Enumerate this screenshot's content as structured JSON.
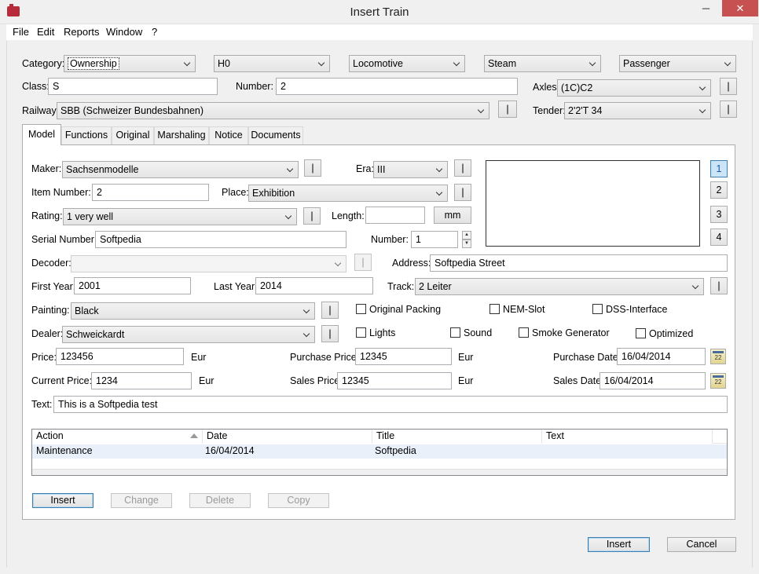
{
  "window": {
    "title": "Insert Train",
    "minimize": "─",
    "maximize": "□",
    "close": "✕"
  },
  "menu": [
    "File",
    "Edit",
    "Reports",
    "Window",
    "?"
  ],
  "header": {
    "category_label": "Category:",
    "category": "Ownership",
    "gauge": "H0",
    "type": "Locomotive",
    "traction": "Steam",
    "service": "Passenger",
    "class_label": "Class:",
    "class": "S",
    "number_label": "Number:",
    "number": "2",
    "axles_label": "Axles:",
    "axles": "(1C)C2",
    "railway_label": "Railway:",
    "railway": "SBB (Schweizer Bundesbahnen)",
    "tender_label": "Tender:",
    "tender": "2'2'T 34",
    "edit_btn": "|"
  },
  "tabs": [
    "Model",
    "Functions",
    "Original",
    "Marshaling",
    "Notice",
    "Documents"
  ],
  "model": {
    "maker_label": "Maker:",
    "maker": "Sachsenmodelle",
    "era_label": "Era:",
    "era": "III",
    "item_number_label": "Item Number:",
    "item_number": "2",
    "place_label": "Place:",
    "place": "Exhibition",
    "rating_label": "Rating:",
    "rating": "1 very well",
    "length_label": "Length:",
    "length": "",
    "length_unit": "mm",
    "serial_label": "Serial Number:",
    "serial": "Softpedia",
    "number_label": "Number:",
    "number": "1",
    "decoder_label": "Decoder:",
    "decoder": "",
    "address_label": "Address:",
    "address": "Softpedia Street",
    "first_year_label": "First Year:",
    "first_year": "2001",
    "last_year_label": "Last Year:",
    "last_year": "2014",
    "track_label": "Track:",
    "track": "2 Leiter",
    "painting_label": "Painting:",
    "painting": "Black",
    "dealer_label": "Dealer:",
    "dealer": "Schweickardt",
    "price_label": "Price:",
    "price": "123456",
    "purchase_price_label": "Purchase Price:",
    "purchase_price": "12345",
    "purchase_date_label": "Purchase Date:",
    "purchase_date": "16/04/2014",
    "current_price_label": "Current Price:",
    "current_price": "1234",
    "sales_price_label": "Sales Price:",
    "sales_price": "12345",
    "sales_date_label": "Sales Date:",
    "sales_date": "16/04/2014",
    "currency": "Eur",
    "text_label": "Text:",
    "text": "This is a Softpedia test",
    "checkboxes": {
      "original_packing": "Original Packing",
      "nem_slot": "NEM-Slot",
      "dss_interface": "DSS-Interface",
      "lights": "Lights",
      "sound": "Sound",
      "smoke_generator": "Smoke Generator",
      "optimized": "Optimized"
    },
    "image_pages": [
      "1",
      "2",
      "3",
      "4"
    ],
    "cal_day": "22"
  },
  "table": {
    "columns": [
      "Action",
      "Date",
      "Title",
      "Text"
    ],
    "rows": [
      {
        "action": "Maintenance",
        "date": "16/04/2014",
        "title": "Softpedia",
        "text": ""
      }
    ]
  },
  "actions": {
    "insert": "Insert",
    "change": "Change",
    "delete": "Delete",
    "copy": "Copy"
  },
  "footer": {
    "insert": "Insert",
    "cancel": "Cancel"
  }
}
